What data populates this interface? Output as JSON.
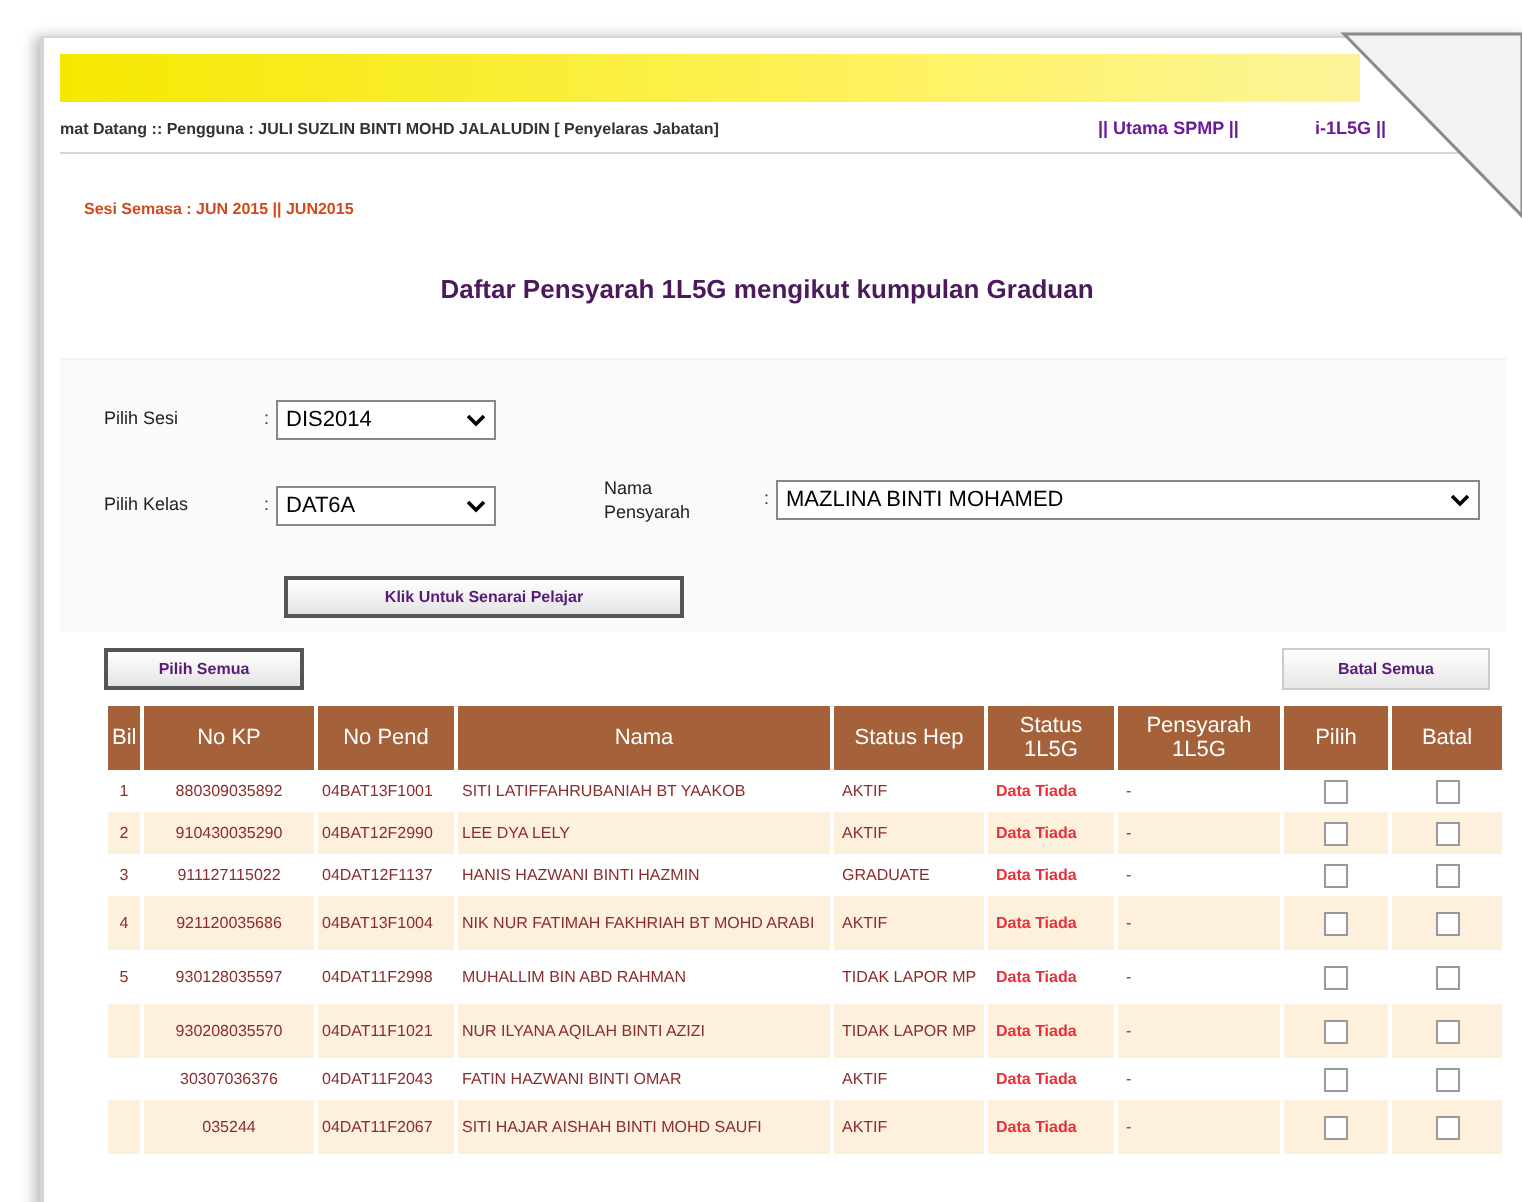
{
  "header": {
    "welcome": "mat Datang :: Pengguna : JULI SUZLIN BINTI MOHD JALALUDIN [ Penyelaras Jabatan]",
    "links": [
      "|| Utama SPMP ||",
      "i-1L5G ||"
    ]
  },
  "session": "Sesi Semasa : JUN 2015 || JUN2015",
  "title": "Daftar Pensyarah 1L5G mengikut kumpulan Graduan",
  "form": {
    "fields": [
      {
        "label": "Pilih Sesi",
        "separator": ":",
        "value": "DIS2014"
      },
      {
        "label": "Pilih Kelas",
        "separator": ":",
        "value": "DAT6A"
      },
      {
        "label": "Nama Pensyarah",
        "separator": ":",
        "value": "MAZLINA BINTI MOHAMED"
      }
    ],
    "submit": "Klik Untuk Senarai Pelajar"
  },
  "select_all": "Pilih Semua",
  "cancel_all": "Batal Semua",
  "table": {
    "columns": [
      "Bil",
      "No KP",
      "No Pend",
      "Nama",
      "Status Hep",
      "Status 1L5G",
      "Pensyarah 1L5G",
      "Pilih",
      "Batal"
    ],
    "rows": [
      {
        "bil": "1",
        "no_kp": "880309035892",
        "no_pend": "04BAT13F1001",
        "nama": "SITI LATIFFAHRUBANIAH BT YAAKOB",
        "status_hep": "AKTIF",
        "status_1l5g": "Data Tiada",
        "pensyarah": "-",
        "pilih": false,
        "batal": false
      },
      {
        "bil": "2",
        "no_kp": "910430035290",
        "no_pend": "04BAT12F2990",
        "nama": "LEE DYA LELY",
        "status_hep": "AKTIF",
        "status_1l5g": "Data Tiada",
        "pensyarah": "-",
        "pilih": false,
        "batal": false
      },
      {
        "bil": "3",
        "no_kp": "911127115022",
        "no_pend": "04DAT12F1137",
        "nama": "HANIS HAZWANI BINTI HAZMIN",
        "status_hep": "GRADUATE",
        "status_1l5g": "Data Tiada",
        "pensyarah": "-",
        "pilih": false,
        "batal": false
      },
      {
        "bil": "4",
        "no_kp": "921120035686",
        "no_pend": "04BAT13F1004",
        "nama": "NIK NUR FATIMAH FAKHRIAH BT MOHD ARABI",
        "status_hep": "AKTIF",
        "status_1l5g": "Data Tiada",
        "pensyarah": "-",
        "pilih": false,
        "batal": false
      },
      {
        "bil": "5",
        "no_kp": "930128035597",
        "no_pend": "04DAT11F2998",
        "nama": "MUHALLIM BIN ABD RAHMAN",
        "status_hep": "TIDAK LAPOR MP",
        "status_1l5g": "Data Tiada",
        "pensyarah": "-",
        "pilih": false,
        "batal": false
      },
      {
        "no_kp": "930208035570",
        "no_pend": "04DAT11F1021",
        "nama": "NUR ILYANA AQILAH BINTI AZIZI",
        "status_hep": "TIDAK LAPOR MP",
        "status_1l5g": "Data Tiada",
        "pensyarah": "-",
        "pilih": false,
        "batal": false
      },
      {
        "no_kp": "30307036376",
        "no_pend": "04DAT11F2043",
        "nama": "FATIN HAZWANI BINTI OMAR",
        "status_hep": "AKTIF",
        "status_1l5g": "Data Tiada",
        "pensyarah": "-",
        "pilih": false,
        "batal": false
      },
      {
        "no_kp": "035244",
        "no_pend": "04DAT11F2067",
        "nama": "SITI HAJAR AISHAH BINTI MOHD SAUFI",
        "status_hep": "AKTIF",
        "status_1l5g": "Data Tiada",
        "pensyarah": "-",
        "pilih": false,
        "batal": false
      }
    ]
  }
}
